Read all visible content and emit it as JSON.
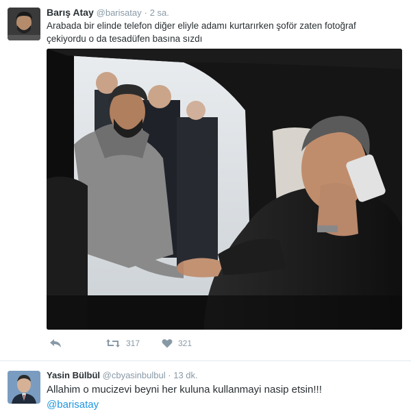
{
  "tweet1": {
    "author_name": "Barış Atay",
    "handle": "@barisatay",
    "separator": "·",
    "time": "2 sa.",
    "text_line1": "Arabada bir elinde telefon diğer eliyle adamı kurtarırken şoför zaten fotoğraf",
    "text_line2": "çekiyordu o da tesadüfen basına sızdı",
    "retweet_count": "317",
    "like_count": "321"
  },
  "tweet2": {
    "author_name": "Yasin Bülbül",
    "handle": "@cbyasinbulbul",
    "separator": "·",
    "time": "13 dk.",
    "text": "Allahim o mucizevi beyni her kuluna kullanmayi nasip etsin!!!",
    "mention": "@barisatay"
  },
  "icons": {
    "reply": "reply-icon",
    "retweet": "retweet-icon",
    "like": "heart-icon"
  },
  "colors": {
    "link": "#1b95e0",
    "muted": "#8899a6",
    "text": "#292f33",
    "divider": "#e1e8ed"
  }
}
